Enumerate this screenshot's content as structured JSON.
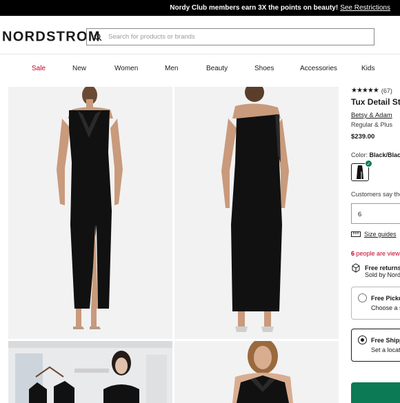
{
  "promo": {
    "text": "Nordy Club members earn 3X the points on beauty!",
    "link": "See Restrictions"
  },
  "header": {
    "logo": "NORDSTROM",
    "search_placeholder": "Search for products or brands"
  },
  "nav": {
    "items": [
      "Sale",
      "New",
      "Women",
      "Men",
      "Beauty",
      "Shoes",
      "Accessories",
      "Kids"
    ],
    "sale_color": "#c4001e"
  },
  "product": {
    "rating_count": "(67)",
    "title": "Tux Detail St",
    "brand": "Betsy & Adam",
    "sizes": "Regular & Plus",
    "price": "$239.00",
    "color_label": "Color:",
    "color_value": "Black/Black",
    "customers_say": "Customers say the",
    "size_value": "6",
    "size_guides": "Size guides",
    "viewing_count": "6",
    "viewing_text": "people are viewi",
    "returns_title": "Free returns",
    "returns_sub": "Sold by Nord",
    "pickup_title": "Free Pickup",
    "pickup_sub": "Choose a s",
    "shipping_title": "Free Shipp",
    "shipping_sub": "Set a locati"
  },
  "colors": {
    "accent_green": "#0b7a55",
    "sale_red": "#c4001e"
  }
}
